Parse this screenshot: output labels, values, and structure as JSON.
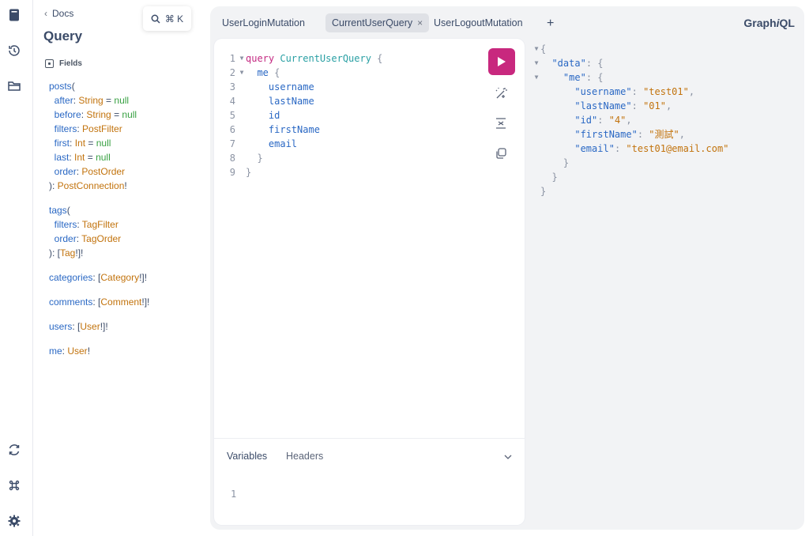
{
  "docs": {
    "back_label": "Docs",
    "title": "Query",
    "search_shortcut": "⌘ K",
    "fields_label": "Fields"
  },
  "tabs": [
    {
      "label": "UserLoginMutation",
      "active": false
    },
    {
      "label": "CurrentUserQuery",
      "active": true
    },
    {
      "label": "UserLogoutMutation",
      "active": false
    }
  ],
  "add_tab_label": "+",
  "brand": {
    "pre": "Graph",
    "ital": "i",
    "post": "QL"
  },
  "editor": {
    "line_numbers": [
      "1",
      "2",
      "3",
      "4",
      "5",
      "6",
      "7",
      "8",
      "9"
    ],
    "keyword": "query",
    "operation_name": "CurrentUserQuery",
    "root_field": "me",
    "fields": [
      "username",
      "lastName",
      "id",
      "firstName",
      "email"
    ]
  },
  "bottom": {
    "variables_label": "Variables",
    "headers_label": "Headers",
    "line_number": "1"
  },
  "result": {
    "data_key": "\"data\"",
    "me_key": "\"me\"",
    "entries": [
      {
        "key": "\"username\"",
        "value": "\"test01\""
      },
      {
        "key": "\"lastName\"",
        "value": "\"01\""
      },
      {
        "key": "\"id\"",
        "value": "\"4\""
      },
      {
        "key": "\"firstName\"",
        "value": "\"測試\""
      },
      {
        "key": "\"email\"",
        "value": "\"test01@email.com\""
      }
    ]
  },
  "colors": {
    "accent": "#c8287e",
    "field": "#2a68c4",
    "type": "#c2730d",
    "null": "#39a143"
  }
}
